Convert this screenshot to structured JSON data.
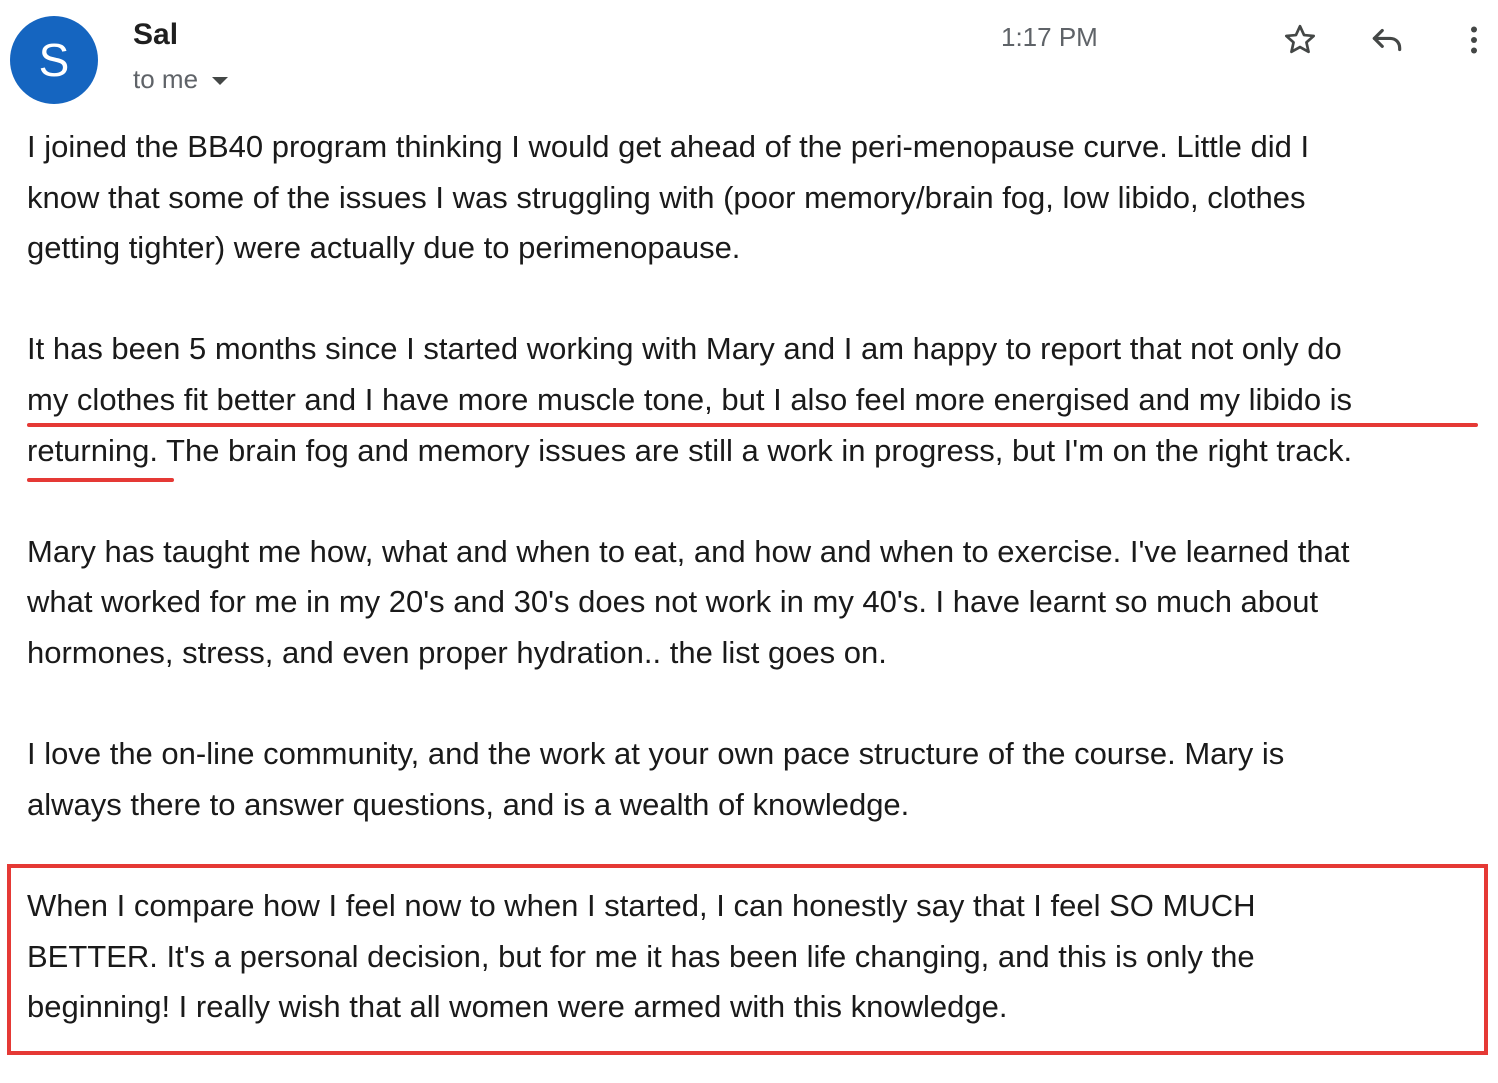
{
  "email": {
    "sender": {
      "avatar_letter": "S",
      "avatar_color": "#1565c0",
      "name": "Sal",
      "recipient": "to me"
    },
    "time": "1:17 PM",
    "actions": {
      "star_icon": "star-outline-icon",
      "reply_icon": "reply-icon",
      "more_icon": "more-vert-icon"
    },
    "paragraphs": [
      "I joined the BB40 program thinking I would get ahead of the peri-menopause curve. Little did I\nknow that some of the issues I was struggling with (poor memory/brain fog, low libido, clothes\ngetting tighter) were actually due to perimenopause.",
      "It has been 5 months since I started working with Mary and I am happy to report that not only do\nmy clothes fit better and I have more muscle tone, but I also feel more energised and my libido is\nreturning. The brain fog and memory issues are still a work in progress, but I'm on the right track.",
      "Mary has taught me how, what and when to eat, and how and when to exercise. I've learned that\nwhat worked for me in my 20's and 30's does not work in my 40's. I have learnt so much about\nhormones, stress, and even proper hydration.. the list goes on.",
      "I love the on-line community, and the work at your own pace structure of the course. Mary is\nalways there to answer questions, and is a wealth of knowledge.",
      "When I compare how I feel now to when I started, I can honestly say that I feel SO MUCH\nBETTER. It's a personal decision, but for me it has been life changing, and this is only the\nbeginning! I really wish that all women were armed with this knowledge."
    ],
    "annotation_color": "#e53935"
  }
}
